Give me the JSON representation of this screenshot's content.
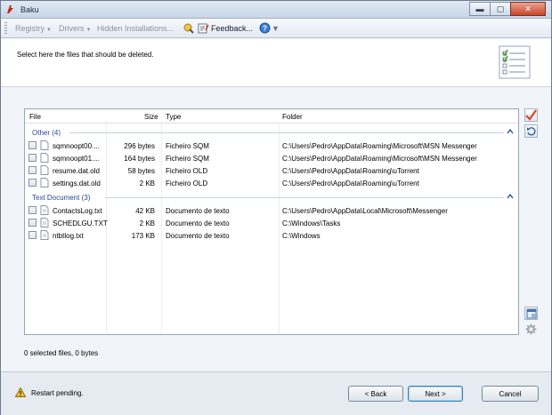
{
  "window": {
    "title": "Baku",
    "minimize_glyph": "▬",
    "maximize_glyph": "▢",
    "close_glyph": "✕"
  },
  "menu": {
    "registry": "Registry",
    "drivers": "Drivers",
    "hidden_installations": "Hidden Installations...",
    "feedback": "Feedback..."
  },
  "header": {
    "instruction": "Select here the files that should be deleted."
  },
  "columns": {
    "file": "File",
    "size": "Size",
    "type": "Type",
    "folder": "Folder"
  },
  "groups": [
    {
      "title": "Other (4)",
      "rows": [
        {
          "name": "sqmnoopt00....",
          "size": "296 bytes",
          "type": "Ficheiro SQM",
          "folder": "C:\\Users\\Pedro\\AppData\\Roaming\\Microsoft\\MSN Messenger"
        },
        {
          "name": "sqmnoopt01....",
          "size": "164 bytes",
          "type": "Ficheiro SQM",
          "folder": "C:\\Users\\Pedro\\AppData\\Roaming\\Microsoft\\MSN Messenger"
        },
        {
          "name": "resume.dat.old",
          "size": "58 bytes",
          "type": "Ficheiro OLD",
          "folder": "C:\\Users\\Pedro\\AppData\\Roaming\\uTorrent"
        },
        {
          "name": "settings.dat.old",
          "size": "2 KB",
          "type": "Ficheiro OLD",
          "folder": "C:\\Users\\Pedro\\AppData\\Roaming\\uTorrent"
        }
      ]
    },
    {
      "title": "Text Document (3)",
      "rows": [
        {
          "name": "ContactsLog.txt",
          "size": "42 KB",
          "type": "Documento de texto",
          "folder": "C:\\Users\\Pedro\\AppData\\Local\\Microsoft\\Messenger"
        },
        {
          "name": "SCHEDLGU.TXT",
          "size": "2 KB",
          "type": "Documento de texto",
          "folder": "C:\\Windows\\Tasks"
        },
        {
          "name": "ntbtlog.txt",
          "size": "173 KB",
          "type": "Documento de texto",
          "folder": "C:\\Windows"
        }
      ]
    }
  ],
  "status": {
    "selection": "0 selected files, 0 bytes"
  },
  "footer": {
    "warning": "Restart pending.",
    "back": "< Back",
    "next": "Next >",
    "cancel": "Cancel"
  },
  "colors": {
    "group_title": "#24479e",
    "accent": "#3c7fb1",
    "check_mark": "#d9472b"
  },
  "icons": [
    "app-icon",
    "feedback-icon",
    "help-icon",
    "checklist-icon",
    "file-icon",
    "check-all-icon",
    "undo-icon",
    "properties-icon",
    "gear-icon",
    "warning-icon",
    "chevron-up-icon"
  ]
}
